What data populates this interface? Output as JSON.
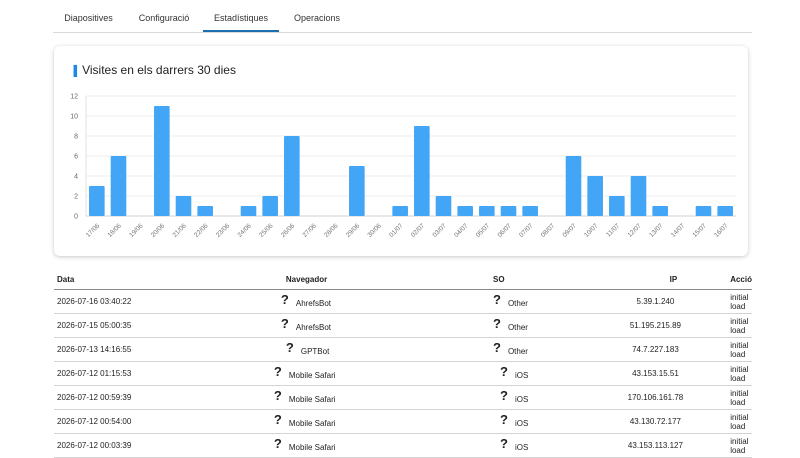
{
  "tabs": [
    {
      "label": "Diapositives",
      "active": false
    },
    {
      "label": "Configuració",
      "active": false
    },
    {
      "label": "Estadístiques",
      "active": true
    },
    {
      "label": "Operacions",
      "active": false
    }
  ],
  "card": {
    "title": "Visites en els darrers 30 dies",
    "accent_icon": "chart-bar-icon"
  },
  "colors": {
    "bar": "#42a5f5",
    "tab_active": "#1b6fae",
    "accent": "#1e88e5"
  },
  "chart_data": {
    "type": "bar",
    "title": "Visites en els darrers 30 dies",
    "xlabel": "",
    "ylabel": "",
    "ylim": [
      0,
      12
    ],
    "yticks": [
      0,
      2,
      4,
      6,
      8,
      10,
      12
    ],
    "grid": true,
    "categories": [
      "17/06",
      "18/06",
      "19/06",
      "20/06",
      "21/06",
      "22/06",
      "23/06",
      "24/06",
      "25/06",
      "26/06",
      "27/06",
      "28/06",
      "29/06",
      "30/06",
      "01/07",
      "02/07",
      "03/07",
      "04/07",
      "05/07",
      "06/07",
      "07/07",
      "08/07",
      "09/07",
      "10/07",
      "11/07",
      "12/07",
      "13/07",
      "14/07",
      "15/07",
      "16/07"
    ],
    "values": [
      3,
      6,
      0,
      11,
      2,
      1,
      0,
      1,
      2,
      8,
      0,
      0,
      5,
      0,
      1,
      9,
      2,
      1,
      1,
      1,
      1,
      0,
      6,
      4,
      2,
      4,
      1,
      0,
      1,
      1
    ]
  },
  "table": {
    "headers": [
      "Data",
      "Navegador",
      "SO",
      "IP",
      "Acció"
    ],
    "rows": [
      {
        "date": "2026-07-16 03:40:22",
        "browser": "AhrefsBot",
        "os": "Other",
        "ip": "5.39.1.240",
        "action": "initial load"
      },
      {
        "date": "2026-07-15 05:00:35",
        "browser": "AhrefsBot",
        "os": "Other",
        "ip": "51.195.215.89",
        "action": "initial load"
      },
      {
        "date": "2026-07-13 14:16:55",
        "browser": "GPTBot",
        "os": "Other",
        "ip": "74.7.227.183",
        "action": "initial load"
      },
      {
        "date": "2026-07-12 01:15:53",
        "browser": "Mobile Safari",
        "os": "iOS",
        "ip": "43.153.15.51",
        "action": "initial load"
      },
      {
        "date": "2026-07-12 00:59:39",
        "browser": "Mobile Safari",
        "os": "iOS",
        "ip": "170.106.161.78",
        "action": "initial load"
      },
      {
        "date": "2026-07-12 00:54:00",
        "browser": "Mobile Safari",
        "os": "iOS",
        "ip": "43.130.72.177",
        "action": "initial load"
      },
      {
        "date": "2026-07-12 00:03:39",
        "browser": "Mobile Safari",
        "os": "iOS",
        "ip": "43.153.113.127",
        "action": "initial load"
      }
    ],
    "unknown_icon": "?"
  }
}
